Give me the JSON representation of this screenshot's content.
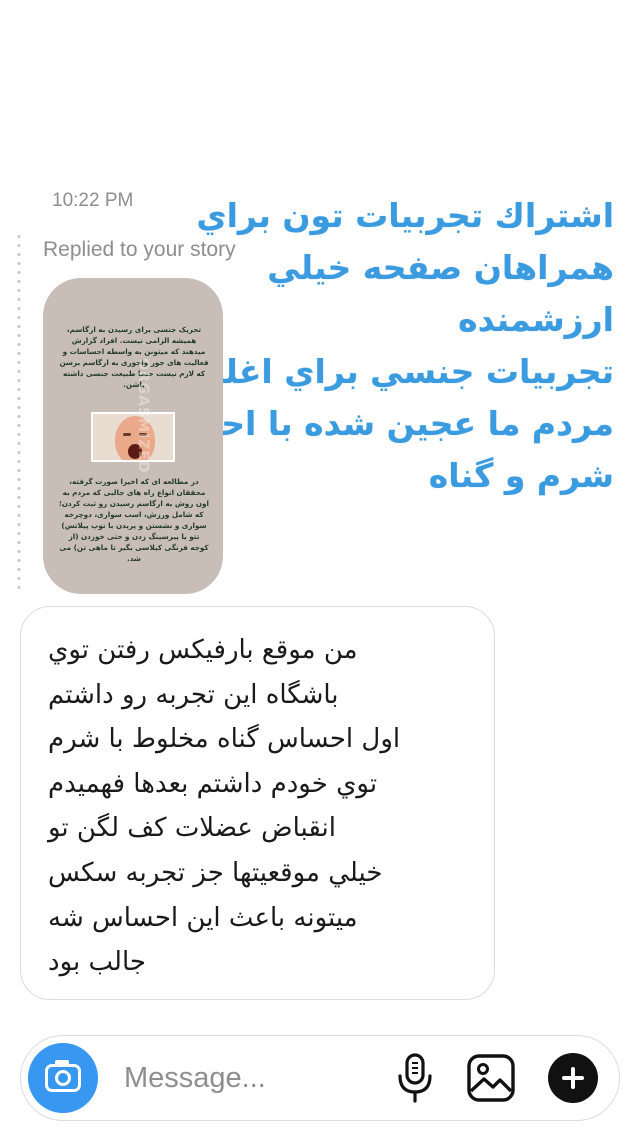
{
  "chat": {
    "timestamp": "10:22 PM",
    "reply_label": "Replied to your story"
  },
  "story": {
    "overlay_lines": [
      "اشتراك تجربيات تون براي",
      "همراهان صفحه خيلي",
      "ارزشمنده",
      "تجربيات جنسي براي اغلب",
      "مردم ما عجين شده با احساس",
      "شرم و گناه"
    ],
    "thumbnail": {
      "top_text": "تحریک جنسی برای رسیدن به ارگاسم، همیشه الزامی نیست. افراد گزارش میدهند که میتونن به واسطه احساسات و فعالیت های جور واجوری به ارگاسم برسن که لازم نیست حتما طبیعت جنسی داشته باشن.",
      "bottom_text": "در مطالعه ای که اخیرا صورت گرفته، محققان انواع راه های جالبی که مردم به اون روش به ارگاسم رسیدن رو ثبت کردن؛ که شامل ورزش، اسب سواری، دوچرخه سواری و نشستن و پریدن با توپ پیلاتس) تتو یا پیرسینگ زدن و حتی خوردن (از کوجه فرنگی کیلاسی بگیر تا ماهی تن) می شد.",
      "watermark": "ORGASMIZED"
    }
  },
  "message": {
    "lines": [
      "من موقع بارفيكس رفتن توي",
      "باشگاه اين تجربه رو داشتم",
      "اول احساس گناه مخلوط با شرم",
      "توي خودم داشتم بعدها فهميدم",
      "انقباض عضلات كف لگن تو",
      "خيلي موقعيتها جز تجربه سكس",
      "ميتونه باعث اين احساس شه",
      "جالب بود"
    ]
  },
  "composer": {
    "placeholder": "Message...",
    "icons": [
      "camera-icon",
      "microphone-icon",
      "gallery-icon",
      "plus-icon"
    ]
  },
  "colors": {
    "accent": "#3897f0",
    "overlay_text": "#3a9be0",
    "muted_text": "#8e8e8e",
    "border": "#dbdbdb"
  }
}
